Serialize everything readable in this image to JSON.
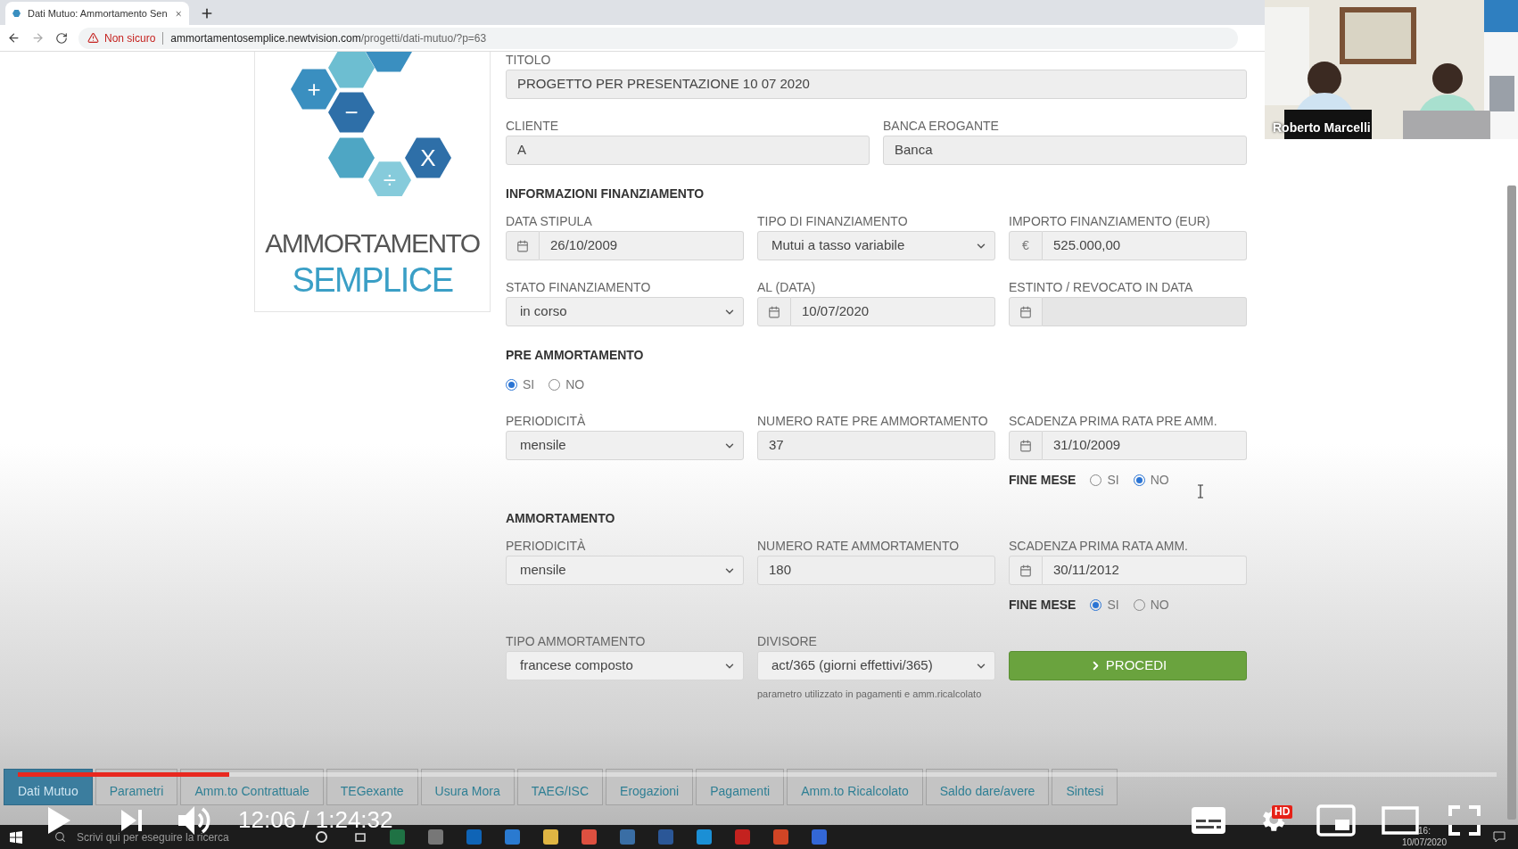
{
  "browser": {
    "tab_title": "Dati Mutuo: Ammortamento Sen",
    "security": "Non sicuro",
    "url_host": "ammortamentosemplice.newtvision.com",
    "url_path": "/progetti/dati-mutuo/?p=63"
  },
  "logo": {
    "operators": [
      "+",
      "−",
      "X",
      "÷"
    ],
    "line1": "AMMORTAMENTO",
    "line2": "SEMPLICE"
  },
  "form": [
    {
      "kind": "fields",
      "fields": [
        {
          "label": "TITOLO",
          "kind": "text",
          "value": "PROGETTO PER PRESENTAZIONE 10 07 2020"
        }
      ]
    },
    {
      "kind": "fields",
      "fields": [
        {
          "label": "CLIENTE",
          "kind": "text",
          "value": "A"
        },
        {
          "label": "BANCA EROGANTE",
          "kind": "text",
          "value": "Banca"
        }
      ]
    },
    {
      "kind": "heading",
      "text": "INFORMAZIONI FINANZIAMENTO"
    },
    {
      "kind": "fields",
      "fields": [
        {
          "label": "DATA STIPULA",
          "kind": "date",
          "value": "26/10/2009"
        },
        {
          "label": "TIPO DI FINANZIAMENTO",
          "kind": "select",
          "value": "Mutui a tasso variabile"
        },
        {
          "label": "IMPORTO FINANZIAMENTO (EUR)",
          "kind": "currency",
          "prefix": "€",
          "value": "525.000,00"
        }
      ]
    },
    {
      "kind": "fields",
      "fields": [
        {
          "label": "STATO FINANZIAMENTO",
          "kind": "select",
          "value": "in corso"
        },
        {
          "label": "AL (DATA)",
          "kind": "date",
          "value": "10/07/2020"
        },
        {
          "label": "ESTINTO / REVOCATO IN DATA",
          "kind": "date"
        }
      ]
    },
    {
      "kind": "heading",
      "text": "PRE AMMORTAMENTO"
    },
    {
      "kind": "radio",
      "options": [
        {
          "label": "SI",
          "selected": true
        },
        {
          "label": "NO",
          "selected": false
        }
      ]
    },
    {
      "kind": "fields",
      "fields": [
        {
          "label": "PERIODICITÀ",
          "kind": "select",
          "value": "mensile"
        },
        {
          "label": "NUMERO RATE PRE AMMORTAMENTO",
          "kind": "text",
          "value": "37"
        },
        {
          "label": "SCADENZA PRIMA RATA PRE AMM.",
          "kind": "date",
          "value": "31/10/2009",
          "fine_mese": {
            "label": "FINE MESE",
            "options": [
              {
                "label": "SI",
                "selected": false
              },
              {
                "label": "NO",
                "selected": true
              }
            ]
          }
        }
      ]
    },
    {
      "kind": "heading",
      "text": "AMMORTAMENTO"
    },
    {
      "kind": "fields",
      "fields": [
        {
          "label": "PERIODICITÀ",
          "kind": "select",
          "value": "mensile"
        },
        {
          "label": "NUMERO RATE AMMORTAMENTO",
          "kind": "text",
          "value": "180"
        },
        {
          "label": "SCADENZA PRIMA RATA AMM.",
          "kind": "date",
          "value": "30/11/2012",
          "fine_mese": {
            "label": "FINE MESE",
            "options": [
              {
                "label": "SI",
                "selected": true
              },
              {
                "label": "NO",
                "selected": false
              }
            ]
          }
        }
      ]
    },
    {
      "kind": "fields",
      "fields": [
        {
          "label": "TIPO AMMORTAMENTO",
          "kind": "select",
          "value": "francese composto"
        },
        {
          "label": "DIVISORE",
          "kind": "select",
          "value": "act/365 (giorni effettivi/365)",
          "hint": "parametro utilizzato in pagamenti e amm.ricalcolato"
        },
        {
          "kind": "button",
          "value": "PROCEDI"
        }
      ]
    }
  ],
  "app_tabs": [
    {
      "label": "Dati Mutuo",
      "selected": true
    },
    {
      "label": "Parametri",
      "selected": false
    },
    {
      "label": "Amm.to Contrattuale",
      "selected": false
    },
    {
      "label": "TEGexante",
      "selected": false
    },
    {
      "label": "Usura Mora",
      "selected": false
    },
    {
      "label": "TAEG/ISC",
      "selected": false
    },
    {
      "label": "Erogazioni",
      "selected": false
    },
    {
      "label": "Pagamenti",
      "selected": false
    },
    {
      "label": "Amm.to Ricalcolato",
      "selected": false
    },
    {
      "label": "Saldo dare/avere",
      "selected": false
    },
    {
      "label": "Sintesi",
      "selected": false
    }
  ],
  "player": {
    "time": "12:06 / 1:24:32",
    "level": 0.143,
    "badge": "HD"
  },
  "webcam": {
    "name": "Roberto Marcelli"
  },
  "taskbar": {
    "search": "Scrivi qui per eseguire la ricerca",
    "time": "16:",
    "date": "10/07/2020"
  }
}
